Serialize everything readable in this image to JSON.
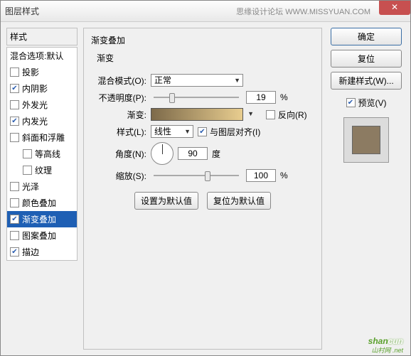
{
  "window": {
    "title": "图层样式",
    "source": "思缘设计论坛  WWW.MISSYUAN.COM"
  },
  "left": {
    "header": "样式",
    "blend_default": "混合选项:默认",
    "items": [
      {
        "label": "投影",
        "checked": false,
        "indent": false
      },
      {
        "label": "内阴影",
        "checked": true,
        "indent": false
      },
      {
        "label": "外发光",
        "checked": false,
        "indent": false
      },
      {
        "label": "内发光",
        "checked": true,
        "indent": false
      },
      {
        "label": "斜面和浮雕",
        "checked": false,
        "indent": false
      },
      {
        "label": "等高线",
        "checked": false,
        "indent": true
      },
      {
        "label": "纹理",
        "checked": false,
        "indent": true
      },
      {
        "label": "光泽",
        "checked": false,
        "indent": false
      },
      {
        "label": "颜色叠加",
        "checked": false,
        "indent": false
      },
      {
        "label": "渐变叠加",
        "checked": true,
        "indent": false,
        "selected": true
      },
      {
        "label": "图案叠加",
        "checked": false,
        "indent": false
      },
      {
        "label": "描边",
        "checked": true,
        "indent": false
      }
    ]
  },
  "panel": {
    "title": "渐变叠加",
    "subtitle": "渐变",
    "blend_mode_label": "混合模式(O):",
    "blend_mode_value": "正常",
    "opacity_label": "不透明度(P):",
    "opacity_value": "19",
    "percent": "%",
    "gradient_label": "渐变:",
    "reverse_label": "反向(R)",
    "style_label": "样式(L):",
    "style_value": "线性",
    "align_label": "与图层对齐(I)",
    "angle_label": "角度(N):",
    "angle_value": "90",
    "angle_unit": "度",
    "scale_label": "缩放(S):",
    "scale_value": "100",
    "set_default": "设置为默认值",
    "reset_default": "复位为默认值"
  },
  "right": {
    "ok": "确定",
    "cancel": "复位",
    "new_style": "新建样式(W)...",
    "preview": "预览(V)"
  },
  "watermark": {
    "text1": "shan",
    "text2": "cun",
    "sub": "山村网 .net"
  }
}
